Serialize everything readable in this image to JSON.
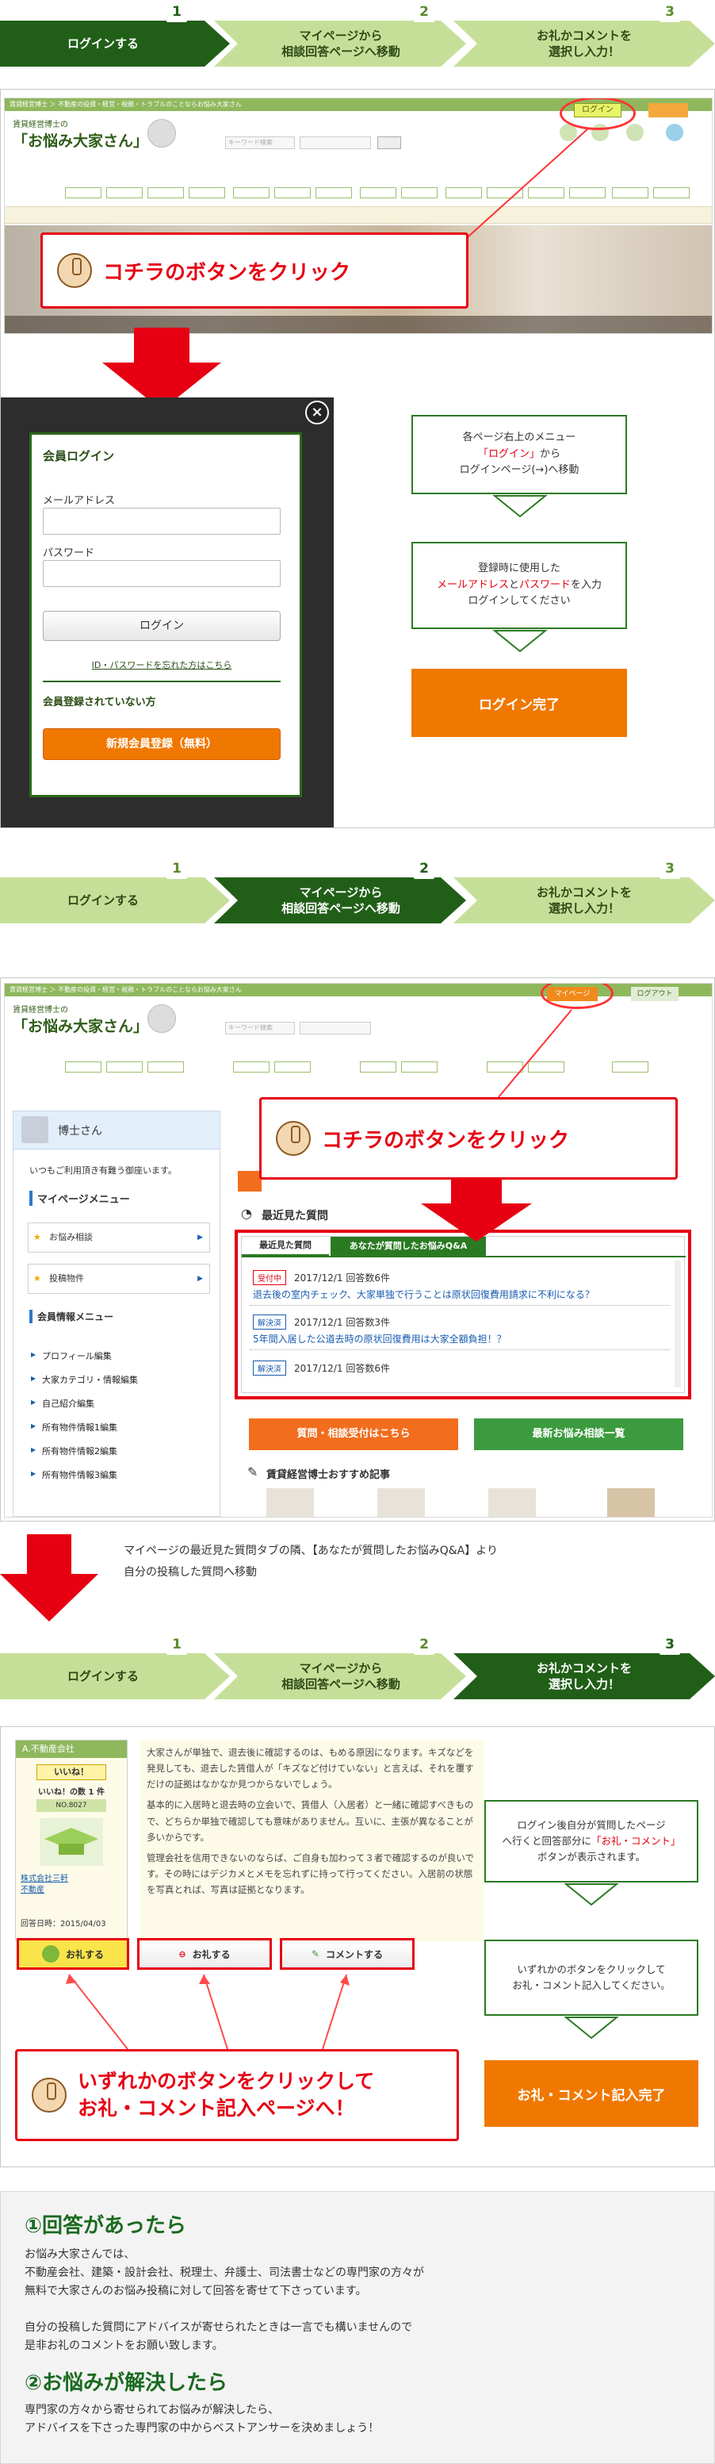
{
  "steps": [
    {
      "num": "1",
      "label": "ログインする"
    },
    {
      "num": "2",
      "label": "マイページから\n相談回答ページへ移動"
    },
    {
      "num": "3",
      "label": "お礼かコメントを\n選択し入力！"
    }
  ],
  "site": {
    "breadcrumb": "賃貸経営博士 ＞ 不動産の投資・経営・税務・トラブルのことならお悩み大家さん",
    "logo_line1": "賃貸経営博士の",
    "logo_line2": "「お悩み大家さん」",
    "login_chip": "ログイン",
    "mypage_chip": "マイページ",
    "logout_chip": "ログアウト",
    "search_placeholder": "キーワード検索"
  },
  "callout_click": "コチラのボタンをクリック",
  "login": {
    "title": "会員ログイン",
    "email_label": "メールアドレス",
    "password_label": "パスワード",
    "login_button": "ログイン",
    "forgot_link": "ID・パスワードを忘れた方はこちら",
    "not_member": "会員登録されていない方",
    "register_button": "新規会員登録（無料）",
    "close": "×"
  },
  "flow1": {
    "box1_a": "各ページ右上のメニュー",
    "box1_red": "「ログイン」",
    "box1_b": "から",
    "box1_c": "ログインページ(→)へ移動",
    "box2_a": "登録時に使用した",
    "box2_red1": "メールアドレス",
    "box2_mid": "と",
    "box2_red2": "パスワード",
    "box2_b": "を入力",
    "box2_c": "ログインしてください",
    "done": "ログイン完了"
  },
  "mypage": {
    "user_name": "博士さん",
    "welcome": "いつもご利用頂き有難う御座います。",
    "menu_title": "マイページメニュー",
    "menu_items": [
      "お悩み相談",
      "投稿物件"
    ],
    "member_menu_title": "会員情報メニュー",
    "member_links": [
      "プロフィール編集",
      "大家カテゴリ・情報編集",
      "自己紹介編集",
      "所有物件情報1編集",
      "所有物件情報2編集",
      "所有物件情報3編集"
    ],
    "recent_title": "最近見た質問",
    "tab_recent": "最近見た質問",
    "tab_mine": "あなたが質問したお悩みQ&A",
    "questions": [
      {
        "badge": "受付中",
        "meta": "2017/12/1 回答数6件",
        "title": "退去後の室内チェック、大家単独で行うことは原状回復費用請求に不利になる？"
      },
      {
        "badge": "解決済",
        "meta": "2017/12/1 回答数3件",
        "title": "5年間入居した公道去時の原状回復費用は大家全額負担！？"
      },
      {
        "badge": "解決済",
        "meta": "2017/12/1 回答数6件",
        "title": ""
      }
    ],
    "btn_consult": "質問・相談受付はこちら",
    "btn_latest": "最新お悩み相談一覧",
    "recommend": "賃貸経営博士おすすめ記事"
  },
  "move_note_line1": "マイページの最近見た質問タブの隣、【あなたが質問したお悩みQ&A】より",
  "move_note_line2": "自分の投稿した質問へ移動",
  "answer": {
    "company_tag": "A.不動産会社",
    "iine": "いいね！",
    "iine_count": "いいね！の数 1 件",
    "no": "NO.8027",
    "company_link1": "株式会社三軒",
    "company_link2": "不動産",
    "reply_date": "回答日時：2015/04/03",
    "paragraphs": [
      "大家さんが単独で、退去後に確認するのは、もめる原因になります。キズなどを発見しても、退去した賃借人が「キズなど付けていない」と言えば、それを覆すだけの証拠はなかなか見つからないでしょう。",
      "基本的に入居時と退去時の立会いで、賃借人（入居者）と一緒に確認すべきもので、どちらか単独で確認しても意味がありません。互いに、主張が異なることが多いからです。",
      "管理会社を信用できないのならば、ご自身も加わって３者で確認するのが良いです。その時にはデジカメとメモを忘れずに持って行ってください。入居前の状態を写真とれば、写真は証拠となります。"
    ],
    "btn_thanks_hi": "お礼する",
    "btn_thanks": "お礼する",
    "btn_comment": "コメントする"
  },
  "flow3": {
    "box1_a": "ログイン後自分が質問したページ",
    "box1_b": "へ行くと回答部分に",
    "box1_red": "「お礼・コメント」",
    "box1_c": "ボタンが表示されます。",
    "box2_a": "いずれかのボタンをクリックして",
    "box2_b": "お礼・コメント記入してください。",
    "done": "お礼・コメント記入完了"
  },
  "callout_choose_l1": "いずれかのボタンをクリックして",
  "callout_choose_l2": "お礼・コメント記入ページへ！",
  "info": {
    "h1": "①回答があったら",
    "p1": "お悩み大家さんでは、\n不動産会社、建築・設計会社、税理士、弁護士、司法書士などの専門家の方々が\n無料で大家さんのお悩み投稿に対して回答を寄せて下さっています。\n\n自分の投稿した質問にアドバイスが寄せられたときは一言でも構いませんので\n是非お礼のコメントをお願い致します。",
    "h2": "②お悩みが解決したら",
    "p2": "専門家の方々から寄せられてお悩みが解決したら、\nアドバイスを下さった専門家の中からベストアンサーを決めましょう！"
  },
  "colors": {
    "accent_green": "#2a6a17",
    "red": "#e60012",
    "orange": "#f07800"
  }
}
